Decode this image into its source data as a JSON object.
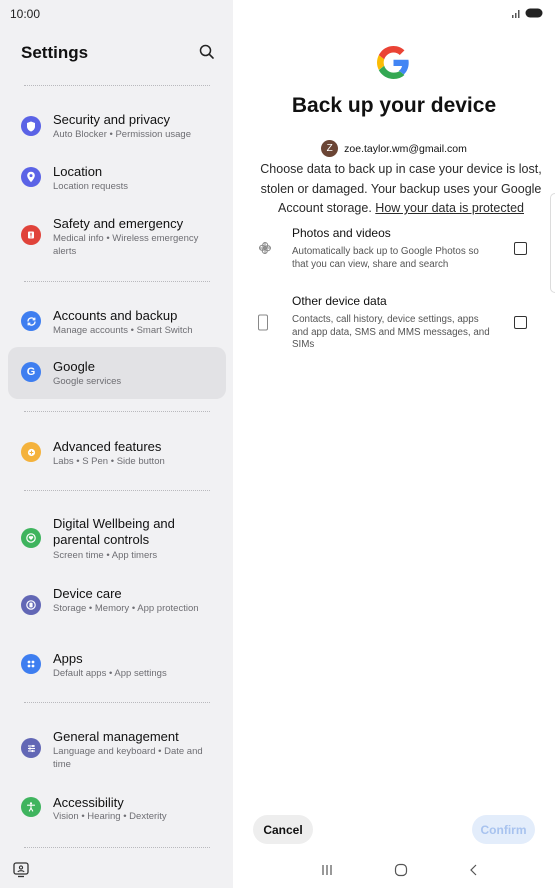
{
  "status": {
    "time": "10:00"
  },
  "settings": {
    "title": "Settings",
    "items": [
      {
        "label": "Security and privacy",
        "sub": "Auto Blocker • Permission usage",
        "icon": "shield-icon",
        "color": "#5b63e6"
      },
      {
        "label": "Location",
        "sub": "Location requests",
        "icon": "location-pin-icon",
        "color": "#5b63e6"
      },
      {
        "label": "Safety and emergency",
        "sub": "Medical info • Wireless emergency alerts",
        "icon": "emergency-icon",
        "color": "#e0433a"
      },
      {
        "label": "Accounts and backup",
        "sub": "Manage accounts • Smart Switch",
        "icon": "sync-icon",
        "color": "#3e7ef0"
      },
      {
        "label": "Google",
        "sub": "Google services",
        "icon": "google-g-icon",
        "color": "#3e7ef0"
      },
      {
        "label": "Advanced features",
        "sub": "Labs • S Pen • Side button",
        "icon": "gear-plus-icon",
        "color": "#f4b23c"
      },
      {
        "label": "Digital Wellbeing and parental controls",
        "sub": "Screen time • App timers",
        "icon": "heart-circle-icon",
        "color": "#3fb45e"
      },
      {
        "label": "Device care",
        "sub": "Storage • Memory • App protection",
        "icon": "device-care-icon",
        "color": "#6267b5"
      },
      {
        "label": "Apps",
        "sub": "Default apps • App settings",
        "icon": "apps-grid-icon",
        "color": "#3e7ef0"
      },
      {
        "label": "General management",
        "sub": "Language and keyboard • Date and time",
        "icon": "sliders-icon",
        "color": "#6267b5"
      },
      {
        "label": "Accessibility",
        "sub": "Vision • Hearing • Dexterity",
        "icon": "accessibility-icon",
        "color": "#3fb45e"
      }
    ],
    "selected": "Google"
  },
  "backup": {
    "title": "Back up your device",
    "avatar_letter": "Z",
    "account_email": "zoe.taylor.wm@gmail.com",
    "intro": "Choose data to back up in case your device is lost, stolen or damaged. Your backup uses your Google Account storage.",
    "intro_link": "How your data is protected",
    "options": [
      {
        "title": "Photos and videos",
        "description": "Automatically back up to Google Photos so that you can view, share and search",
        "checked": false,
        "icon": "pinwheel-icon"
      },
      {
        "title": "Other device data",
        "description": "Contacts, call history, device settings, apps and app data, SMS and MMS messages, and SIMs",
        "checked": false,
        "icon": "phone-outline-icon"
      }
    ],
    "cancel_label": "Cancel",
    "confirm_label": "Confirm"
  },
  "colors": {
    "left_bg": "#f1f1f3",
    "selected_bg": "#e2e2e5",
    "confirm_disabled_bg": "#e3edfb",
    "confirm_disabled_text": "#a8c3ef"
  }
}
